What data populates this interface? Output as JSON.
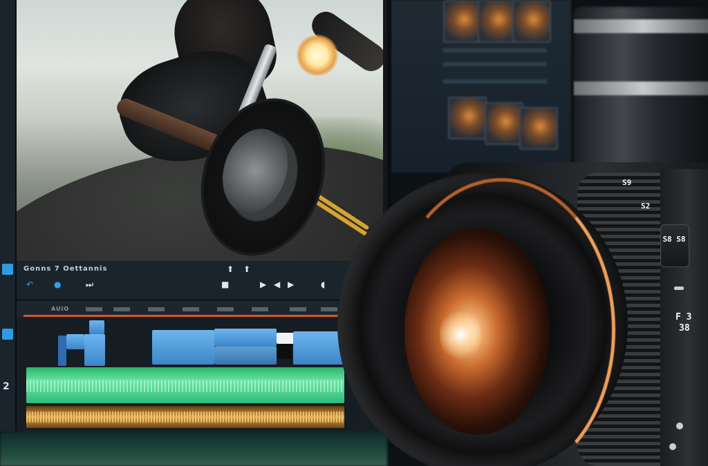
{
  "preview": {
    "timecode": "Gonns  7  Oettannis"
  },
  "timeline": {
    "track_labels": [
      "AUIO",
      "",
      "",
      "",
      "",
      "",
      "",
      "",
      ""
    ]
  },
  "sidebar": {
    "numbers": [
      "2"
    ]
  },
  "lens": {
    "marks": [
      "S9",
      "S2",
      "S8 S8",
      "F 3",
      "38"
    ]
  }
}
